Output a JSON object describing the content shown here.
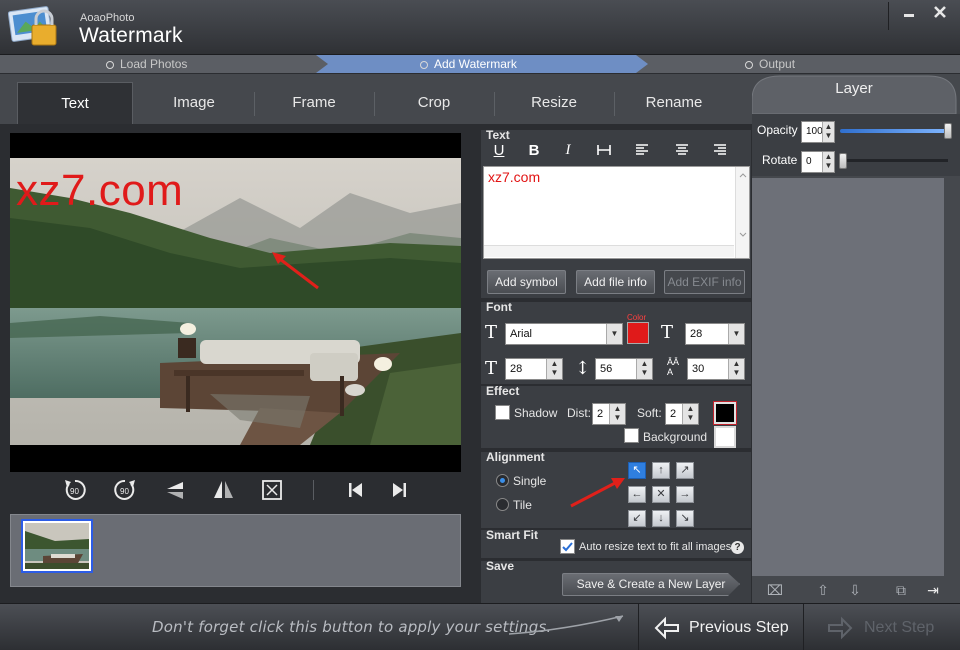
{
  "app": {
    "small_title": "AoaoPhoto",
    "title": "Watermark"
  },
  "window": {
    "minimize": "▬",
    "close": "✕"
  },
  "steps": {
    "load": "Load Photos",
    "add": "Add Watermark",
    "output": "Output"
  },
  "tabs": [
    "Text",
    "Image",
    "Frame",
    "Crop",
    "Resize",
    "Rename"
  ],
  "preview": {
    "watermark_text": "xz7.com"
  },
  "text_section": {
    "title": "Text",
    "value": "xz7.com",
    "add_symbol": "Add symbol",
    "add_file_info": "Add file info",
    "add_exif_info": "Add EXIF info"
  },
  "font_section": {
    "title": "Font",
    "family": "Arial",
    "color_label": "Color",
    "color": "#e01a1a",
    "size": "28",
    "width": "28",
    "height": "56",
    "spacing": "30"
  },
  "effect_section": {
    "title": "Effect",
    "shadow_label": "Shadow",
    "dist_label": "Dist:",
    "dist": "2",
    "soft_label": "Soft:",
    "soft": "2",
    "background_label": "Background"
  },
  "alignment_section": {
    "title": "Alignment",
    "single_label": "Single",
    "tile_label": "Tile",
    "mode": "Single"
  },
  "smart_fit_section": {
    "title": "Smart Fit",
    "auto_resize_label": "Auto resize text to fit all images.",
    "help": "?"
  },
  "save_section": {
    "title": "Save",
    "button": "Save & Create a New Layer"
  },
  "layer": {
    "title": "Layer",
    "opacity_label": "Opacity",
    "opacity": "100",
    "rotate_label": "Rotate",
    "rotate": "0"
  },
  "bottom": {
    "hint": "Don't forget click this button to apply your settings.",
    "previous": "Previous Step",
    "next": "Next Step"
  }
}
